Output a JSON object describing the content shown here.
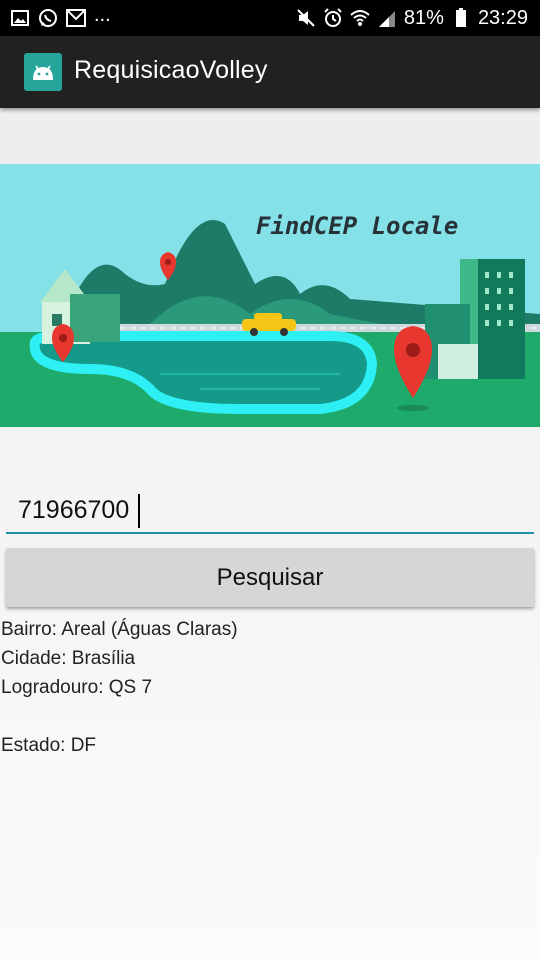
{
  "status_bar": {
    "left_icons": [
      "image-icon",
      "whatsapp-icon",
      "gmail-icon"
    ],
    "more": "...",
    "battery": "81%",
    "time": "23:29"
  },
  "app_bar": {
    "title": "RequisicaoVolley",
    "logo_icon": "android-icon"
  },
  "banner": {
    "title": "FindCEP Locale",
    "colors": {
      "sky": "#84e1e8",
      "grass": "#1eaa6a",
      "road_blue": "#2ef0f4",
      "pin": "#e8372f",
      "taxi": "#f5c518"
    }
  },
  "form": {
    "cep_value": "71966700",
    "search_label": "Pesquisar"
  },
  "results": {
    "bairro": "Bairro: Areal (Águas Claras)",
    "cidade": "Cidade: Brasília",
    "logradouro": "Logradouro: QS 7",
    "estado": "Estado: DF"
  }
}
